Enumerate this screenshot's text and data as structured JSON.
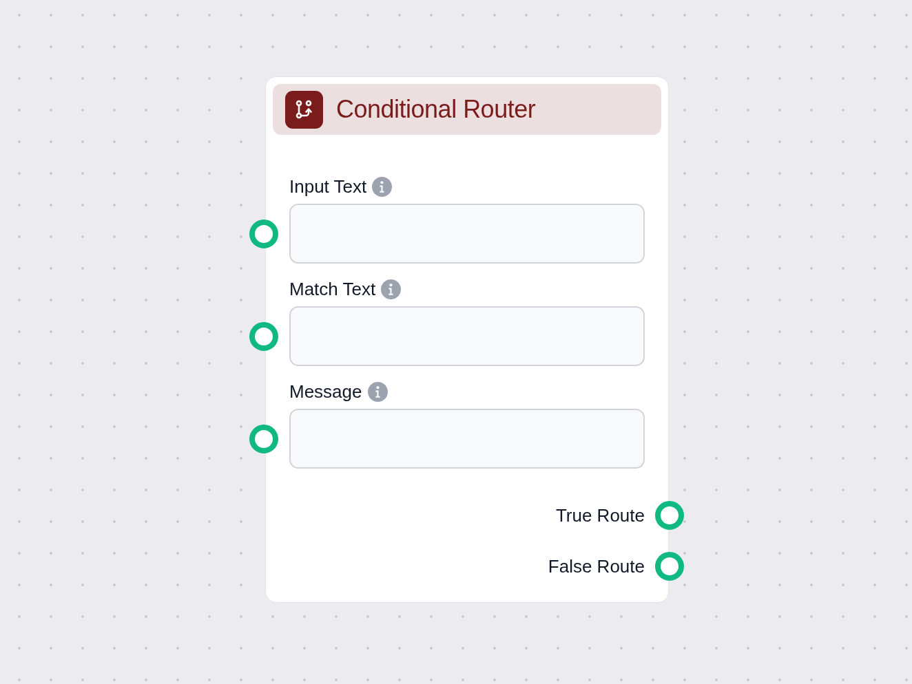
{
  "node": {
    "title": "Conditional Router",
    "inputs": [
      {
        "label": "Input Text"
      },
      {
        "label": "Match Text"
      },
      {
        "label": "Message"
      }
    ],
    "outputs": [
      {
        "label": "True Route"
      },
      {
        "label": "False Route"
      }
    ]
  }
}
